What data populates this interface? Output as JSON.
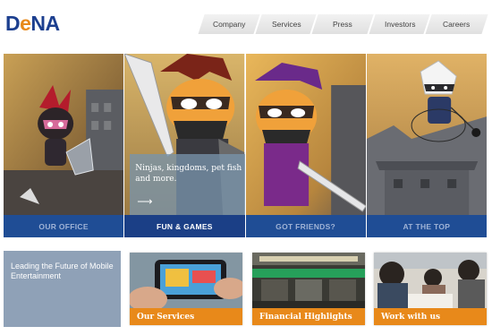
{
  "header": {
    "logo": {
      "d": "D",
      "e": "e",
      "rest": "NA"
    },
    "nav": [
      "Company",
      "Services",
      "Press",
      "Investors",
      "Careers"
    ]
  },
  "hero": {
    "panels": [
      {
        "caption": "OUR OFFICE"
      },
      {
        "caption": "FUN & GAMES"
      },
      {
        "caption": "GOT FRIENDS?"
      },
      {
        "caption": "AT THE TOP"
      }
    ],
    "active_panel": "FUN & GAMES",
    "blurb": "Ninjas, kingdoms, pet fish and more.",
    "blurb_arrow": "⟶"
  },
  "bottom": {
    "lead": "Leading the Future of Mobile Entertainment",
    "tiles": [
      {
        "label": "Our Services"
      },
      {
        "label": "Financial Highlights"
      },
      {
        "label": "Work with us"
      }
    ]
  },
  "colors": {
    "brand_blue": "#1c3f8f",
    "accent_orange": "#e8891a",
    "caption_blue": "#1f4d95",
    "lead_gray_blue": "#8fa1b7"
  },
  "icons": [
    "arrow-right-icon"
  ]
}
